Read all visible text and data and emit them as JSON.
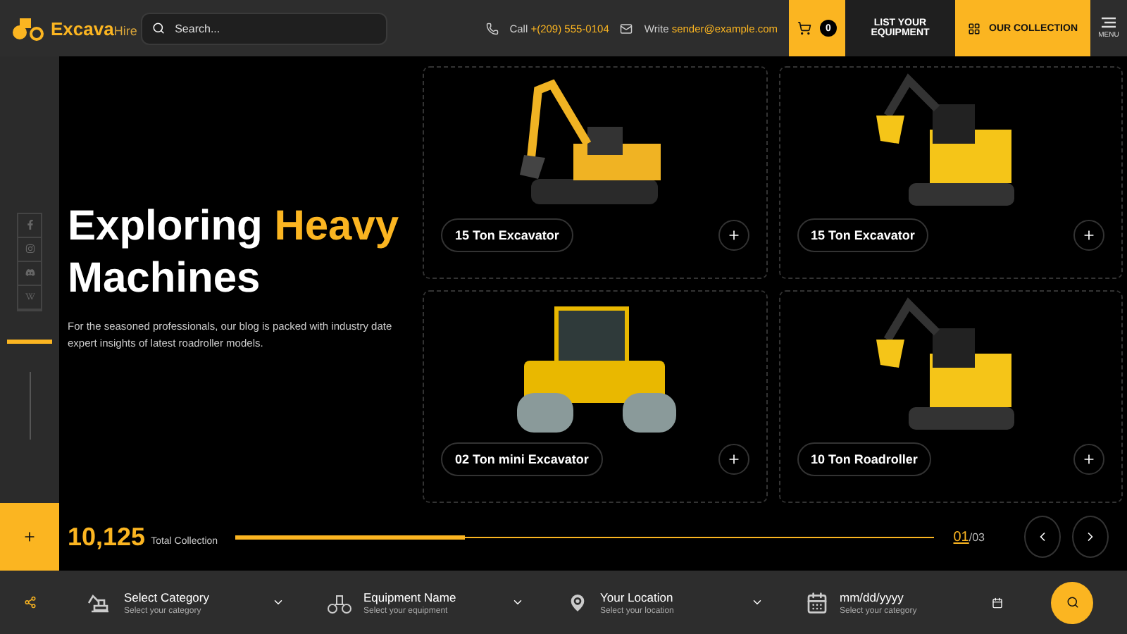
{
  "header": {
    "brand": {
      "main": "Excava",
      "sub": "Hire"
    },
    "search": {
      "placeholder": "Search..."
    },
    "call": {
      "label": "Call",
      "value": "+(209) 555-0104"
    },
    "mail": {
      "label": "Write",
      "value": "sender@example.com"
    },
    "cart": {
      "count": "0"
    },
    "list_button": "LIST YOUR EQUIPMENT",
    "collection_button": "OUR COLLECTION",
    "menu_label": "MENU"
  },
  "hero": {
    "lead": "Exploring",
    "highlight": "Heavy",
    "tail": "Machines",
    "text": "For the seasoned professionals, our blog is packed with industry date expert insights of latest roadroller models."
  },
  "products": [
    {
      "name": "15 Ton Excavator",
      "kind": "excavator"
    },
    {
      "name": "15 Ton Excavator",
      "kind": "compact"
    },
    {
      "name": "02 Ton mini Excavator",
      "kind": "roller"
    },
    {
      "name": "10 Ton Roadroller",
      "kind": "compact"
    }
  ],
  "stats": {
    "count": "10,125",
    "label": "Total Collection",
    "level": 0.33,
    "current": "01",
    "total": "/03"
  },
  "filters": [
    {
      "kind": "select",
      "value": "Select Category",
      "hint": "Select your category"
    },
    {
      "kind": "select",
      "value": "Equipment Name",
      "hint": "Select your equipment"
    },
    {
      "kind": "select",
      "value": "Your Location",
      "hint": "Select your location"
    },
    {
      "kind": "date",
      "placeholder": "mm/dd/yyyy",
      "hint": "Select your category"
    }
  ]
}
